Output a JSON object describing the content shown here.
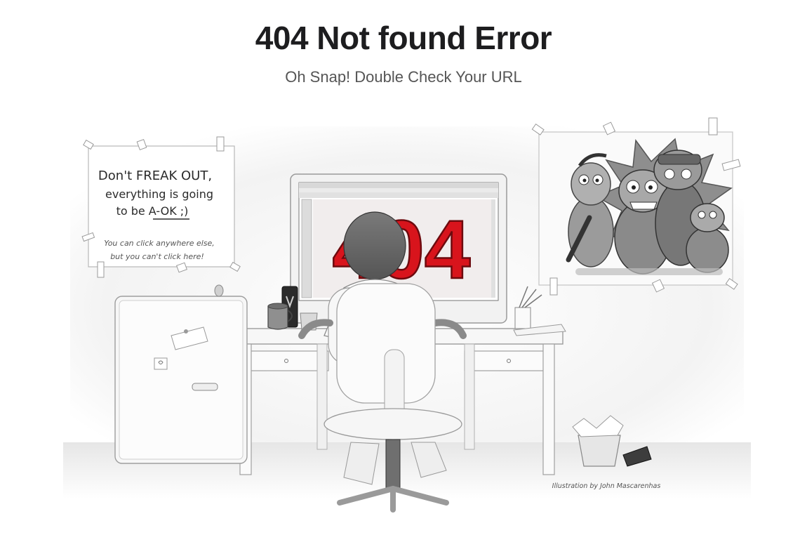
{
  "header": {
    "title": "404 Not found Error",
    "subtitle": "Oh Snap! Double Check Your URL"
  },
  "illustration": {
    "note": {
      "line1": "Don't FREAK OUT,",
      "line2": "everything is going",
      "line3": "to be A-OK ;)",
      "line4": "You can click anywhere else,",
      "line5": "but you can't click here!"
    },
    "screen_text": "404",
    "credit": "Illustration by John Mascarenhas"
  },
  "colors": {
    "accent_red": "#d8141c",
    "sketch_gray": "#8a8a8a",
    "wall": "#f4f4f4"
  }
}
